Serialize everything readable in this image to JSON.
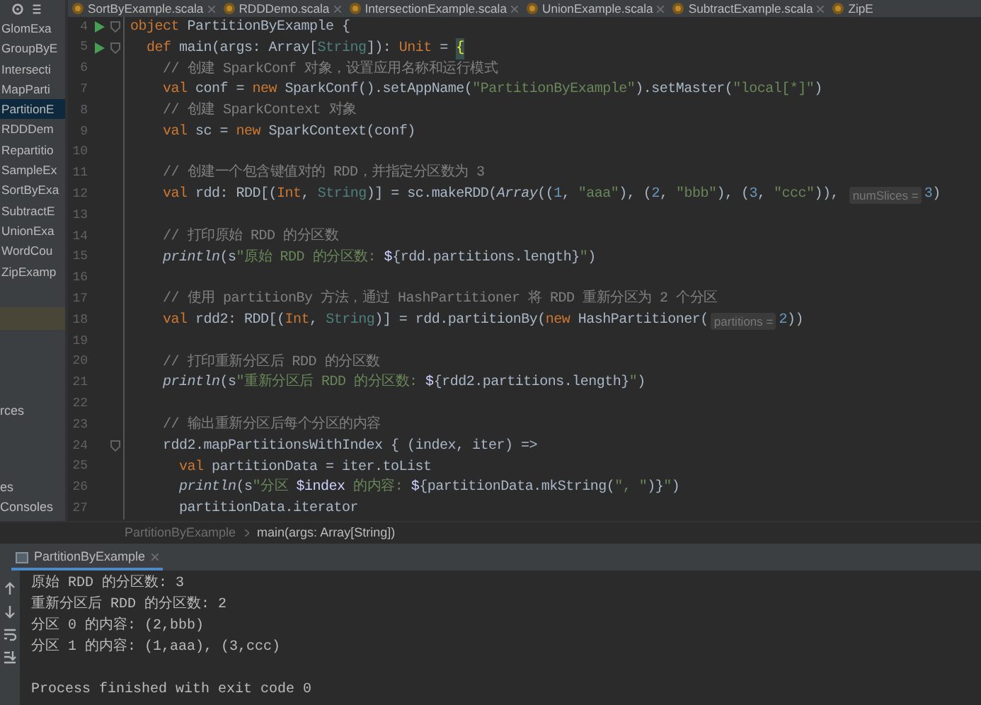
{
  "tabs": [
    {
      "label": "SortByExample.scala",
      "selected": false
    },
    {
      "label": "RDDDemo.scala",
      "selected": false
    },
    {
      "label": "IntersectionExample.scala",
      "selected": false
    },
    {
      "label": "UnionExample.scala",
      "selected": false
    },
    {
      "label": "SubtractExample.scala",
      "selected": false
    },
    {
      "label": "ZipE",
      "selected": false
    }
  ],
  "sidebar": {
    "items": [
      {
        "label": "GlomExa",
        "selected": false
      },
      {
        "label": "GroupByE",
        "selected": false
      },
      {
        "label": "Intersecti",
        "selected": false
      },
      {
        "label": "MapParti",
        "selected": false
      },
      {
        "label": "PartitionE",
        "selected": true
      },
      {
        "label": "RDDDem",
        "selected": false
      },
      {
        "label": "Repartitio",
        "selected": false
      },
      {
        "label": "SampleEx",
        "selected": false
      },
      {
        "label": "SortByExa",
        "selected": false
      },
      {
        "label": "SubtractE",
        "selected": false
      },
      {
        "label": "UnionExa",
        "selected": false
      },
      {
        "label": "WordCou",
        "selected": false
      },
      {
        "label": "ZipExamp",
        "selected": false
      }
    ],
    "lower_items": [
      "rces",
      "es",
      "Consoles"
    ]
  },
  "editor": {
    "lines": [
      {
        "number": "4",
        "run": true,
        "fold": true,
        "tokens": [
          {
            "kind": "kw",
            "t": "object"
          },
          {
            "kind": "plain",
            "t": " PartitionByExample {"
          }
        ]
      },
      {
        "number": "5",
        "run": true,
        "fold": true,
        "tokens": [
          {
            "kind": "kw",
            "t": "  def"
          },
          {
            "kind": "plain",
            "t": " main(args: Array["
          },
          {
            "kind": "type",
            "t": "String"
          },
          {
            "kind": "plain",
            "t": "]): "
          },
          {
            "kind": "kw",
            "t": "Unit"
          },
          {
            "kind": "plain",
            "t": " = "
          },
          {
            "kind": "brace",
            "t": "{"
          }
        ]
      },
      {
        "number": "6",
        "tokens": [
          {
            "kind": "cmt",
            "t": "    // 创建 SparkConf 对象，设置应用名称和运行模式"
          }
        ]
      },
      {
        "number": "7",
        "tokens": [
          {
            "kind": "kw",
            "t": "    val"
          },
          {
            "kind": "plain",
            "t": " conf = "
          },
          {
            "kind": "kw",
            "t": "new"
          },
          {
            "kind": "plain",
            "t": " SparkConf().setAppName("
          },
          {
            "kind": "str",
            "t": "\"PartitionByExample\""
          },
          {
            "kind": "plain",
            "t": ").setMaster("
          },
          {
            "kind": "str",
            "t": "\"local[*]\""
          },
          {
            "kind": "plain",
            "t": ")"
          }
        ]
      },
      {
        "number": "8",
        "tokens": [
          {
            "kind": "cmt",
            "t": "    // 创建 SparkContext 对象"
          }
        ]
      },
      {
        "number": "9",
        "tokens": [
          {
            "kind": "kw",
            "t": "    val"
          },
          {
            "kind": "plain",
            "t": " sc = "
          },
          {
            "kind": "kw",
            "t": "new"
          },
          {
            "kind": "plain",
            "t": " SparkContext(conf)"
          }
        ]
      },
      {
        "number": "10"
      },
      {
        "number": "11",
        "tokens": [
          {
            "kind": "cmt",
            "t": "    // 创建一个包含键值对的 RDD，并指定分区数为 3"
          }
        ]
      },
      {
        "number": "12",
        "tokens": [
          {
            "kind": "kw",
            "t": "    val"
          },
          {
            "kind": "plain",
            "t": " rdd: RDD[("
          },
          {
            "kind": "kw",
            "t": "Int"
          },
          {
            "kind": "plain",
            "t": ", "
          },
          {
            "kind": "type",
            "t": "String"
          },
          {
            "kind": "plain",
            "t": ")] = sc.makeRDD("
          },
          {
            "kind": "fn",
            "t": "Array"
          },
          {
            "kind": "plain",
            "t": "(("
          },
          {
            "kind": "num",
            "t": "1"
          },
          {
            "kind": "plain",
            "t": ", "
          },
          {
            "kind": "str",
            "t": "\"aaa\""
          },
          {
            "kind": "plain",
            "t": "), ("
          },
          {
            "kind": "num",
            "t": "2"
          },
          {
            "kind": "plain",
            "t": ", "
          },
          {
            "kind": "str",
            "t": "\"bbb\""
          },
          {
            "kind": "plain",
            "t": "), ("
          },
          {
            "kind": "num",
            "t": "3"
          },
          {
            "kind": "plain",
            "t": ", "
          },
          {
            "kind": "str",
            "t": "\"ccc\""
          },
          {
            "kind": "plain",
            "t": ")), "
          },
          {
            "kind": "hint",
            "t": "numSlices ="
          },
          {
            "kind": "num",
            "t": "3"
          },
          {
            "kind": "plain",
            "t": ")"
          }
        ]
      },
      {
        "number": "13"
      },
      {
        "number": "14",
        "tokens": [
          {
            "kind": "cmt",
            "t": "    // 打印原始 RDD 的分区数"
          }
        ]
      },
      {
        "number": "15",
        "tokens": [
          {
            "kind": "fn",
            "t": "    println"
          },
          {
            "kind": "plain",
            "t": "(s"
          },
          {
            "kind": "str",
            "t": "\"原始 RDD 的分区数: "
          },
          {
            "kind": "interp",
            "t": "$"
          },
          {
            "kind": "plain",
            "t": "{rdd.partitions.length}"
          },
          {
            "kind": "str",
            "t": "\""
          },
          {
            "kind": "plain",
            "t": ")"
          }
        ]
      },
      {
        "number": "16"
      },
      {
        "number": "17",
        "tokens": [
          {
            "kind": "cmt",
            "t": "    // 使用 partitionBy 方法，通过 HashPartitioner 将 RDD 重新分区为 2 个分区"
          }
        ]
      },
      {
        "number": "18",
        "tokens": [
          {
            "kind": "kw",
            "t": "    val"
          },
          {
            "kind": "plain",
            "t": " rdd2: RDD[("
          },
          {
            "kind": "kw",
            "t": "Int"
          },
          {
            "kind": "plain",
            "t": ", "
          },
          {
            "kind": "type",
            "t": "String"
          },
          {
            "kind": "plain",
            "t": ")] = rdd.partitionBy("
          },
          {
            "kind": "kw",
            "t": "new"
          },
          {
            "kind": "plain",
            "t": " HashPartitioner("
          },
          {
            "kind": "hint",
            "t": "partitions ="
          },
          {
            "kind": "num",
            "t": "2"
          },
          {
            "kind": "plain",
            "t": "))"
          }
        ]
      },
      {
        "number": "19"
      },
      {
        "number": "20",
        "tokens": [
          {
            "kind": "cmt",
            "t": "    // 打印重新分区后 RDD 的分区数"
          }
        ]
      },
      {
        "number": "21",
        "tokens": [
          {
            "kind": "fn",
            "t": "    println"
          },
          {
            "kind": "plain",
            "t": "(s"
          },
          {
            "kind": "str",
            "t": "\"重新分区后 RDD 的分区数: "
          },
          {
            "kind": "interp",
            "t": "$"
          },
          {
            "kind": "plain",
            "t": "{rdd2.partitions.length}"
          },
          {
            "kind": "str",
            "t": "\""
          },
          {
            "kind": "plain",
            "t": ")"
          }
        ]
      },
      {
        "number": "22"
      },
      {
        "number": "23",
        "tokens": [
          {
            "kind": "cmt",
            "t": "    // 输出重新分区后每个分区的内容"
          }
        ]
      },
      {
        "number": "24",
        "fold": true,
        "tokens": [
          {
            "kind": "plain",
            "t": "    rdd2.mapPartitionsWithIndex { (index, iter) =>"
          }
        ]
      },
      {
        "number": "25",
        "tokens": [
          {
            "kind": "kw",
            "t": "      val"
          },
          {
            "kind": "plain",
            "t": " partitionData = iter.toList"
          }
        ]
      },
      {
        "number": "26",
        "tokens": [
          {
            "kind": "fn",
            "t": "      println"
          },
          {
            "kind": "plain",
            "t": "(s"
          },
          {
            "kind": "str",
            "t": "\"分区 "
          },
          {
            "kind": "interp",
            "t": "$index"
          },
          {
            "kind": "str",
            "t": " 的内容: "
          },
          {
            "kind": "interp",
            "t": "$"
          },
          {
            "kind": "plain",
            "t": "{partitionData.mkString("
          },
          {
            "kind": "str",
            "t": "\", \""
          },
          {
            "kind": "plain",
            "t": ")}"
          },
          {
            "kind": "str",
            "t": "\""
          },
          {
            "kind": "plain",
            "t": ")"
          }
        ]
      },
      {
        "number": "27",
        "tokens": [
          {
            "kind": "plain",
            "t": "      partitionData.iterator"
          }
        ]
      }
    ]
  },
  "breadcrumb": [
    "PartitionByExample",
    "main(args: Array[String])"
  ],
  "run_panel": {
    "tab": {
      "label": "PartitionByExample",
      "selected": true
    },
    "output": [
      "原始 RDD 的分区数: 3",
      "重新分区后 RDD 的分区数: 2",
      "分区 0 的内容: (2,bbb)",
      "分区 1 的内容: (1,aaa), (3,ccc)"
    ],
    "exit_message": "Process finished with exit code 0"
  }
}
